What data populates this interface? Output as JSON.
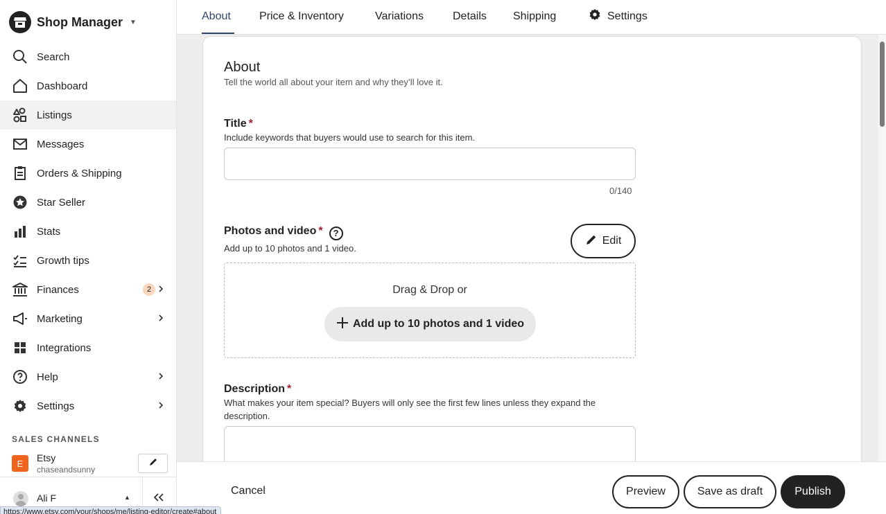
{
  "sidebar": {
    "brand_title": "Shop Manager",
    "items": [
      {
        "label": "Search",
        "icon": "search-icon"
      },
      {
        "label": "Dashboard",
        "icon": "home-icon"
      },
      {
        "label": "Listings",
        "icon": "shapes-icon",
        "active": true
      },
      {
        "label": "Messages",
        "icon": "envelope-icon"
      },
      {
        "label": "Orders & Shipping",
        "icon": "clipboard-icon"
      },
      {
        "label": "Star Seller",
        "icon": "star-badge-icon"
      },
      {
        "label": "Stats",
        "icon": "bar-chart-icon"
      },
      {
        "label": "Growth tips",
        "icon": "checklist-icon"
      },
      {
        "label": "Finances",
        "icon": "bank-icon",
        "badge": "2"
      },
      {
        "label": "Marketing",
        "icon": "megaphone-icon"
      },
      {
        "label": "Integrations",
        "icon": "grid-icon"
      },
      {
        "label": "Help",
        "icon": "question-icon"
      },
      {
        "label": "Settings",
        "icon": "gear-icon"
      }
    ],
    "sales_channels_label": "SALES CHANNELS",
    "channel": {
      "letter": "E",
      "name": "Etsy",
      "shop": "chaseandsunny"
    },
    "user_name": "Ali F"
  },
  "status_url": "https://www.etsy.com/your/shops/me/listing-editor/create#about",
  "tabs": [
    "About",
    "Price & Inventory",
    "Variations",
    "Details",
    "Shipping",
    "Settings"
  ],
  "form": {
    "heading": "About",
    "subheading": "Tell the world all about your item and why they’ll love it.",
    "title": {
      "label": "Title",
      "help": "Include keywords that buyers would use to search for this item.",
      "value": "",
      "counter": "0/140"
    },
    "photos": {
      "label": "Photos and video",
      "help": "Add up to 10 photos and 1 video.",
      "edit_label": "Edit",
      "drop_text": "Drag & Drop or",
      "add_label": "Add up to 10 photos and 1 video"
    },
    "description": {
      "label": "Description",
      "help": "What makes your item special? Buyers will only see the first few lines unless they expand the description.",
      "value": ""
    },
    "required_mark": "*"
  },
  "footer": {
    "cancel": "Cancel",
    "preview": "Preview",
    "save_draft": "Save as draft",
    "publish": "Publish"
  },
  "colors": {
    "accent": "#2f466c",
    "required": "#a61a2e",
    "etsy_orange": "#f1641e",
    "badge": "#fbd7be"
  }
}
